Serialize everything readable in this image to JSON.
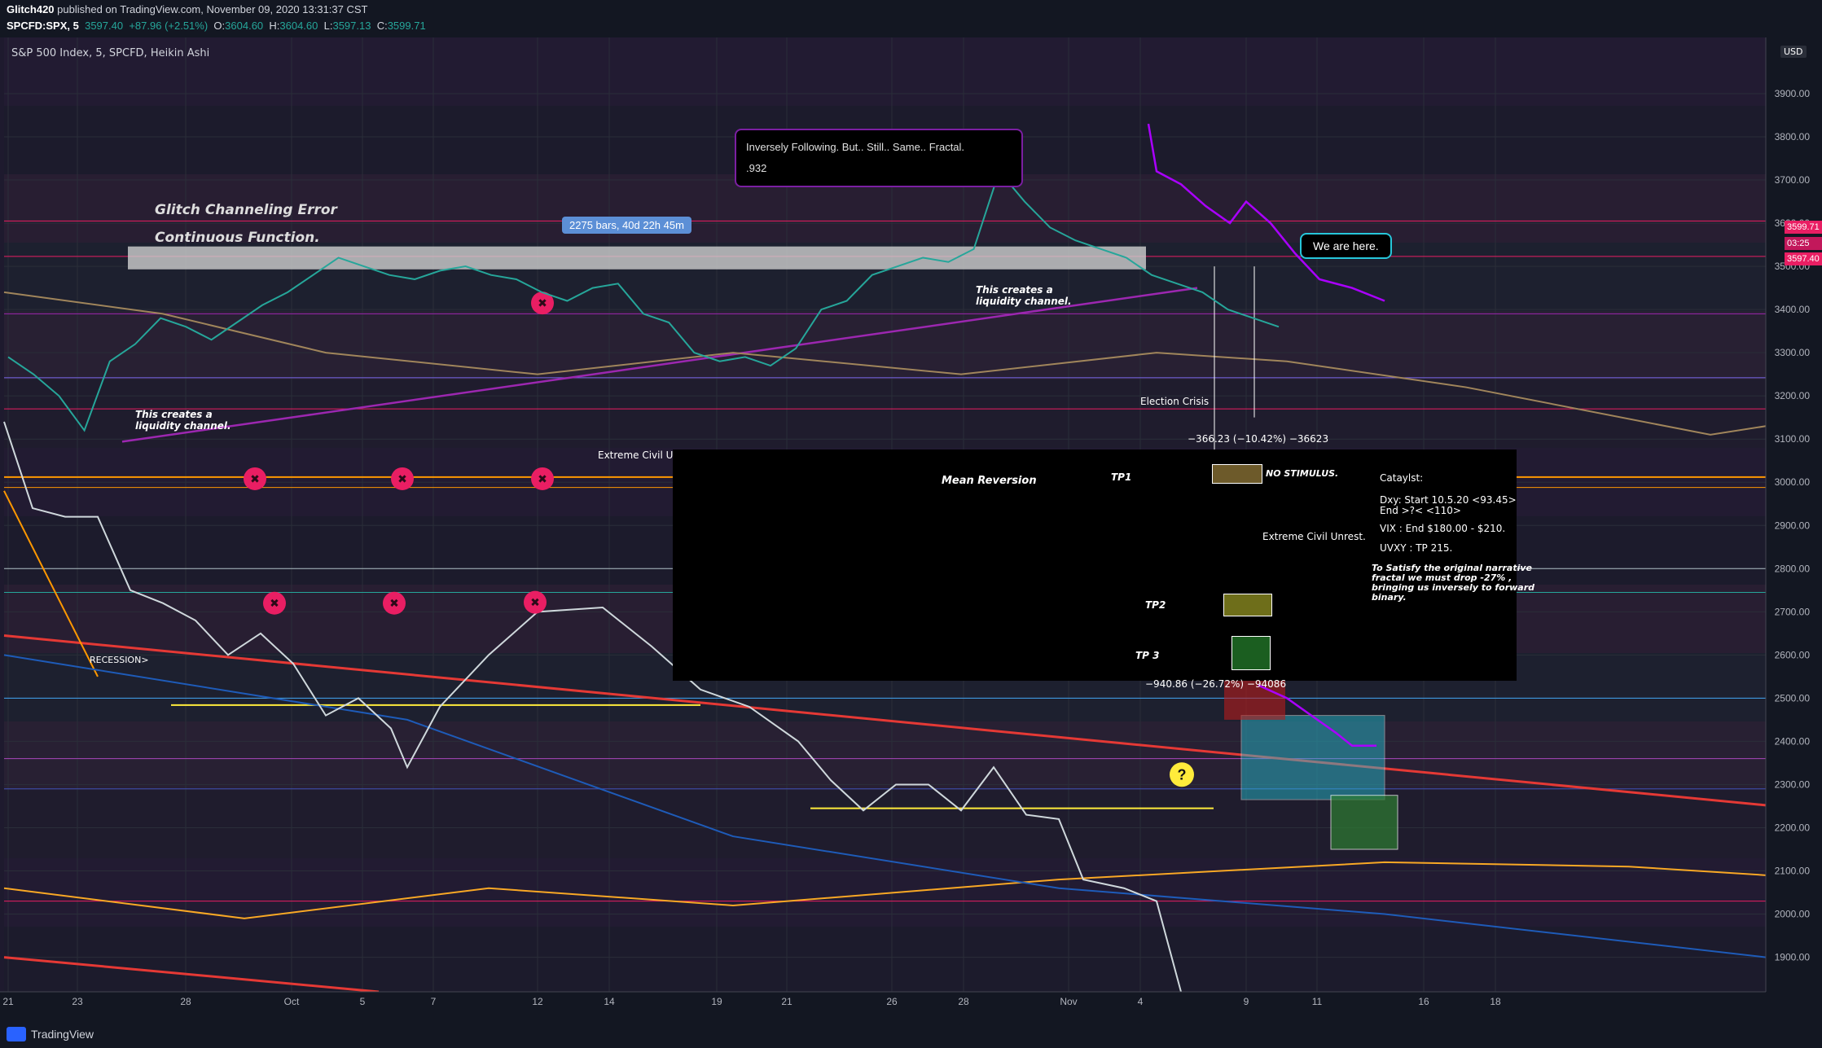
{
  "header": {
    "publisher": "Glitch420",
    "published_line": "published on TradingView.com, November 09, 2020 13:31:37 CST",
    "symbol": "SPCFD:SPX, 5",
    "last": "3597.40",
    "change": "+87.96 (+2.51%)",
    "o_label": "O:",
    "o": "3604.60",
    "h_label": "H:",
    "h": "3604.60",
    "l_label": "L:",
    "l": "3597.13",
    "c_label": "C:",
    "c": "3599.71",
    "instrument": "S&P 500 Index, 5, SPCFD, Heikin Ashi",
    "currency": "USD"
  },
  "footer": {
    "brand": "TradingView"
  },
  "price_tags": {
    "current": "3599.71",
    "countdown": "03:25",
    "last": "3597.40"
  },
  "annotations": {
    "glitch1": "Glitch Channeling Error",
    "glitch2": "Continuous Function.",
    "bars_pill": "2275 bars, 40d 22h 45m",
    "callout_line1": "Inversely Following. But.. Still.. Same.. Fractal.",
    "callout_line2": ".932",
    "we_are_here": "We are here.",
    "liq1a": "This creates a",
    "liq1b": "liquidity channel.",
    "liq2a": "This creates a",
    "liq2b": "liquidity channel.",
    "election": "Election Crisis",
    "measure1": "−366.23 (−10.42%) −36623",
    "extreme1": "Extreme Civil Unr",
    "mean_rev": "Mean Reversion",
    "tp1": "TP1",
    "no_stim": "NO STIMULUS.",
    "extreme2": "Extreme Civil Unrest.",
    "tp2": "TP2",
    "tp3": "TP 3",
    "measure2": "−940.86 (−26.72%) −94086",
    "recession": "RECESSION>",
    "catalyst_title": "Cataylst:",
    "cat1": "Dxy: Start 10.5.20 <93.45>",
    "cat2": "End >?< <110>",
    "cat3": "VIX : End $180.00 - $210.",
    "cat4": "UVXY : TP 215.",
    "note1": "To Satisfy the original narrative",
    "note2": "fractal we must drop -27% ,",
    "note3": "bringing us inversely to forward",
    "note4": "binary.",
    "qmark": "?",
    "xmark": "✖"
  },
  "chart_data": {
    "type": "line",
    "title": "S&P 500 Index, 5, SPCFD, Heikin Ashi",
    "y_ticks": [
      3900,
      3800,
      3700,
      3600,
      3500,
      3400,
      3300,
      3200,
      3100,
      3000,
      2900,
      2800,
      2700,
      2600,
      2500,
      2400,
      2300,
      2200,
      2100,
      2000,
      1900
    ],
    "y_tick_labels": [
      "3900.00",
      "3800.00",
      "3700.00",
      "3600.00",
      "3500.00",
      "3400.00",
      "3300.00",
      "3200.00",
      "3100.00",
      "3000.00",
      "2900.00",
      "2800.00",
      "2700.00",
      "2600.00",
      "2500.00",
      "2400.00",
      "2300.00",
      "2200.00",
      "2100.00",
      "2000.00",
      "1900.00"
    ],
    "ylim": [
      1820,
      4030
    ],
    "x_tick_labels": [
      "21",
      "23",
      "28",
      "Oct",
      "5",
      "7",
      "12",
      "14",
      "19",
      "21",
      "26",
      "28",
      "Nov",
      "4",
      "9",
      "11",
      "16",
      "18"
    ],
    "series": [
      {
        "name": "SPX",
        "x": [
          0,
          2,
          4,
          6,
          8,
          10,
          12,
          14,
          16,
          18,
          20,
          22,
          24,
          26,
          28,
          30,
          32,
          34,
          36,
          38,
          40,
          42,
          44,
          46,
          48,
          50,
          52,
          54,
          56,
          58,
          60,
          62,
          64,
          66,
          68,
          70,
          72,
          74,
          76,
          78,
          80,
          82,
          84,
          86,
          88,
          90,
          92,
          94,
          96,
          98,
          100
        ],
        "y": [
          3290,
          3250,
          3200,
          3120,
          3280,
          3320,
          3380,
          3360,
          3330,
          3370,
          3410,
          3440,
          3480,
          3520,
          3500,
          3480,
          3470,
          3490,
          3500,
          3480,
          3470,
          3440,
          3420,
          3450,
          3460,
          3390,
          3370,
          3300,
          3280,
          3290,
          3270,
          3310,
          3400,
          3420,
          3480,
          3500,
          3520,
          3510,
          3540,
          3720,
          3650,
          3590,
          3560,
          3540,
          3520,
          3480,
          3460,
          3440,
          3400,
          3380,
          3360
        ]
      }
    ],
    "grid": true
  }
}
